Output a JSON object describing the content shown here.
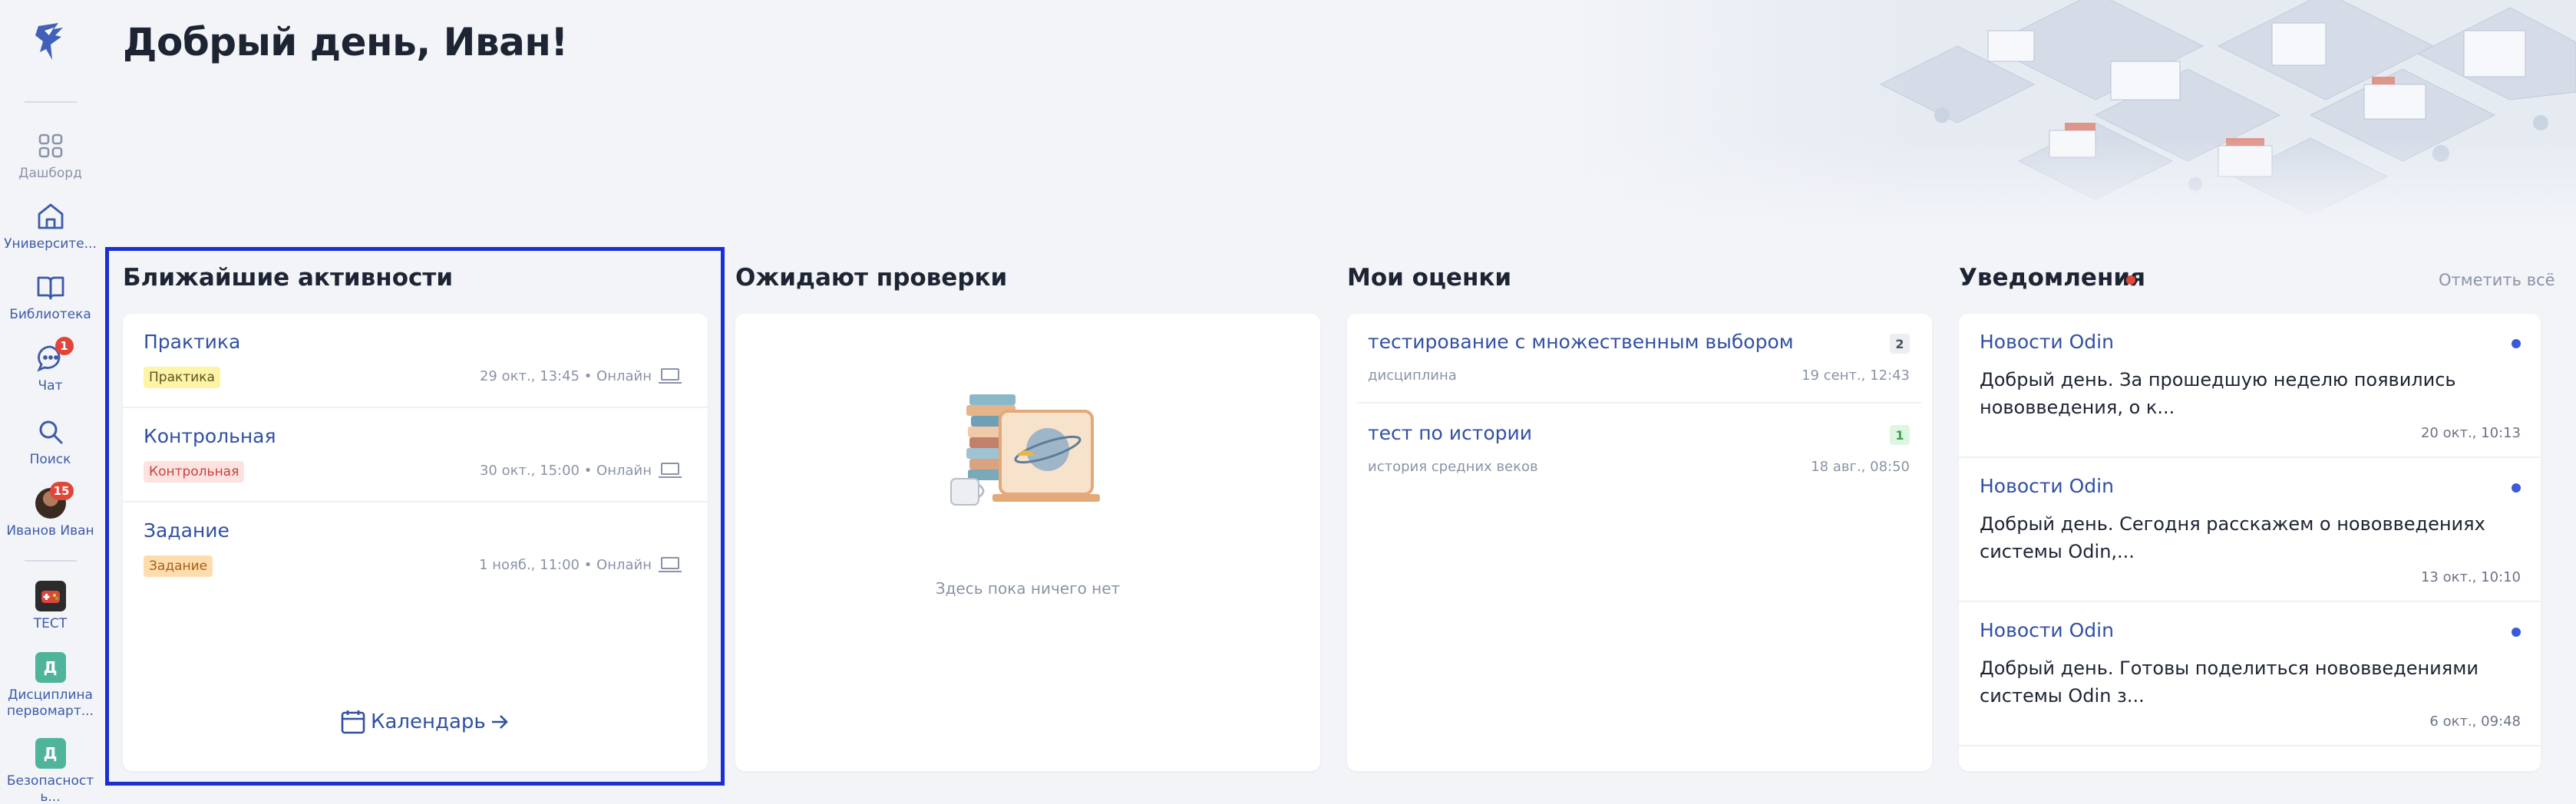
{
  "greeting": "Добрый день, Иван!",
  "colors": {
    "accent": "#3150a3",
    "highlight_border": "#1a2fd1",
    "badge_red": "#e0463a",
    "unread_dot": "#3a5ad9"
  },
  "sidebar": {
    "logo_icon": "griffin-logo-icon",
    "items": [
      {
        "label": "Дашборд",
        "icon": "grid-icon"
      },
      {
        "label": "Университе...",
        "icon": "home-icon"
      },
      {
        "label": "Библиотека",
        "icon": "book-icon"
      },
      {
        "label": "Чат",
        "icon": "chat-icon",
        "badge": "1"
      },
      {
        "label": "Поиск",
        "icon": "search-icon"
      },
      {
        "label": "Иванов Иван",
        "icon": "avatar",
        "badge": "15"
      }
    ],
    "courses": [
      {
        "label": "ТЕСТ",
        "icon": "game-icon"
      },
      {
        "label": "Дисциплина первомарт...",
        "letter": "Д"
      },
      {
        "label": "Безопасност ь...",
        "letter": "Д"
      }
    ]
  },
  "activities": {
    "title": "Ближайшие активности",
    "items": [
      {
        "title": "Практика",
        "tag": "Практика",
        "meta": "29 окт., 13:45 • Онлайн"
      },
      {
        "title": "Контрольная",
        "tag": "Контрольная",
        "meta": "30 окт., 15:00 • Онлайн"
      },
      {
        "title": "Задание",
        "tag": "Задание",
        "meta": "1 нояб., 11:00 • Онлайн"
      }
    ],
    "calendar_link": "Календарь"
  },
  "review": {
    "title": "Ожидают проверки",
    "empty_text": "Здесь пока ничего нет"
  },
  "grades": {
    "title": "Мои оценки",
    "items": [
      {
        "title": "тестирование с множественным выбором",
        "subject": "дисциплина",
        "date": "19 сент., 12:43",
        "grade": "2"
      },
      {
        "title": "тест по истории",
        "subject": "история средних веков",
        "date": "18 авг., 08:50",
        "grade": "1"
      }
    ]
  },
  "notifications": {
    "title": "Уведомления",
    "mark_all": "Отметить всё",
    "items": [
      {
        "source": "Новости Odin",
        "text": "Добрый день. За прошедшую неделю появились нововведения, о к...",
        "time": "20 окт., 10:13"
      },
      {
        "source": "Новости Odin",
        "text": "Добрый день. Сегодня расскажем о нововведениях системы Odin,...",
        "time": "13 окт., 10:10"
      },
      {
        "source": "Новости Odin",
        "text": "Добрый день. Готовы поделиться нововведениями системы Odin з...",
        "time": "6 окт., 09:48"
      }
    ]
  }
}
